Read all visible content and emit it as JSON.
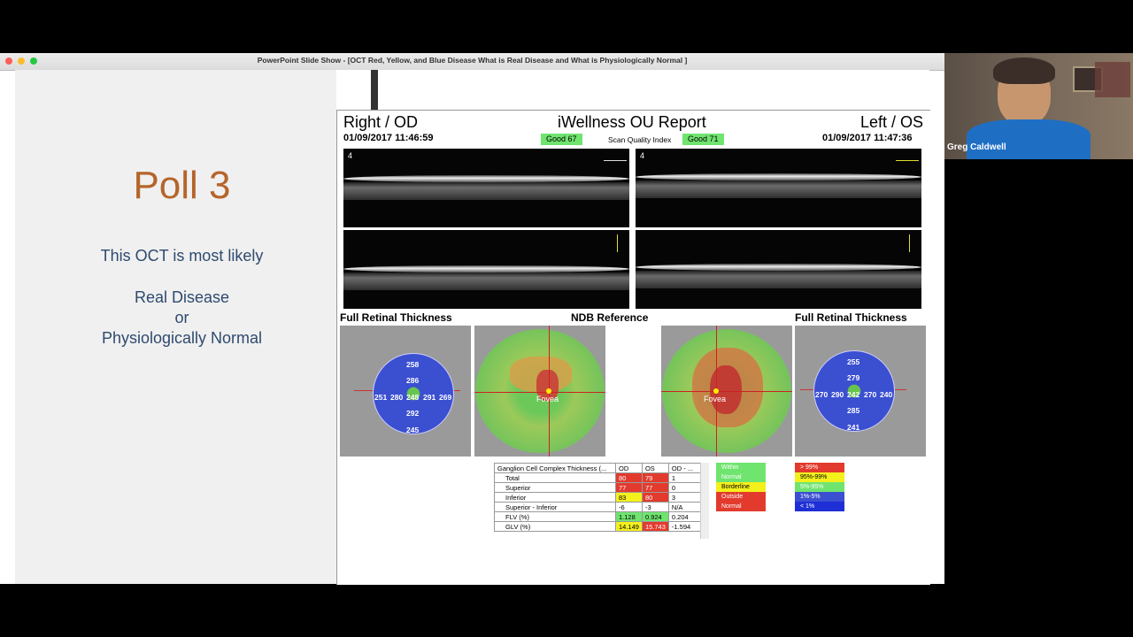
{
  "window": {
    "title": "PowerPoint Slide Show - [OCT Red, Yellow, and Blue Disease What is Real Disease and What is Physiologically Normal ]"
  },
  "slide": {
    "heading": "Poll 3",
    "question": "This OCT is most likely",
    "option1": "Real Disease",
    "or": "or",
    "option2": "Physiologically Normal"
  },
  "report": {
    "left_label": "Right / OD",
    "center_title": "iWellness OU Report",
    "right_label": "Left / OS",
    "date_od": "01/09/2017 11:46:59",
    "date_os": "01/09/2017 11:47:36",
    "quality_od": "Good  67",
    "quality_label": "Scan Quality Index",
    "quality_os": "Good  71",
    "scan_number": "4",
    "section_left": "Full Retinal Thickness",
    "section_center": "NDB Reference",
    "section_right": "Full Retinal Thickness",
    "fovea_label": "Fovea",
    "od_values": {
      "top": "258",
      "inner_top": "286",
      "left": "251",
      "inner_left": "280",
      "center": "248",
      "inner_right": "291",
      "right": "269",
      "inner_bottom": "292",
      "bottom": "245"
    },
    "os_values": {
      "top": "255",
      "inner_top": "279",
      "left": "270",
      "inner_left": "290",
      "center": "242",
      "inner_right": "270",
      "right": "240",
      "inner_bottom": "285",
      "bottom": "241"
    },
    "table": {
      "headers": [
        "Ganglion Cell Complex Thickness (...",
        "OD",
        "OS",
        "OD - ..."
      ],
      "rows": [
        {
          "label": "Total",
          "od": "80",
          "os": "79",
          "diff": "1"
        },
        {
          "label": "Superior",
          "od": "77",
          "os": "77",
          "diff": "0"
        },
        {
          "label": "Inferior",
          "od": "83",
          "os": "80",
          "diff": "3"
        },
        {
          "label": "Superior - Inferior",
          "od": "-6",
          "os": "-3",
          "diff": "N/A"
        },
        {
          "label": "FLV (%)",
          "od": "1.128",
          "os": "0.924",
          "diff": "0.204"
        },
        {
          "label": "GLV (%)",
          "od": "14.149",
          "os": "15.743",
          "diff": "-1.594"
        }
      ]
    },
    "legend1": [
      "Within",
      "Normal",
      "Borderline",
      "Outside",
      "Normal"
    ],
    "legend2": [
      "> 99%",
      "95%-99%",
      "5%-95%",
      "1%-5%",
      "< 1%"
    ]
  },
  "webcam": {
    "name": "Greg Caldwell"
  },
  "colors": {
    "heading": "#b5652b",
    "body_text": "#2e4a6f",
    "good": "#6fe46f",
    "red": "#e23b2e",
    "yellow": "#f4f01c",
    "green": "#6fe46f",
    "blue": "#1f2fd6"
  }
}
